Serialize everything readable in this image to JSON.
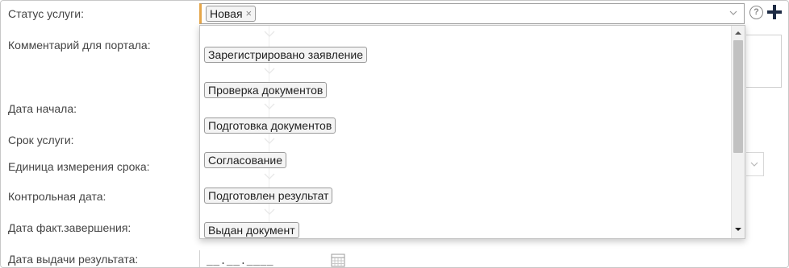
{
  "form": {
    "labels": {
      "status": "Статус услуги:",
      "comment": "Комментарий для портала:",
      "start_date": "Дата начала:",
      "service_term": "Срок услуги:",
      "term_unit": "Единица измерения срока:",
      "control_date": "Контрольная дата:",
      "actual_completion_date": "Дата факт.завершения:",
      "result_issue_date": "Дата выдачи результата:"
    },
    "status_selected": "Новая",
    "chip_remove_symbol": "×",
    "help_symbol": "?",
    "result_issue_date_mask": "__.__.____"
  },
  "dropdown": {
    "options": [
      "Зарегистрировано заявление",
      "Проверка документов",
      "Подготовка документов",
      "Согласование",
      "Подготовлен результат",
      "Выдан документ"
    ]
  },
  "icons": {
    "select": "chevron-down-icon",
    "help": "help-icon",
    "add": "plus-icon",
    "date": "calendar-icon",
    "flow": "arrow-down-icon"
  },
  "colors": {
    "required_accent": "#e5a64a",
    "chip_border": "#9a9a9a",
    "scroll_thumb": "#c1c1c1"
  }
}
